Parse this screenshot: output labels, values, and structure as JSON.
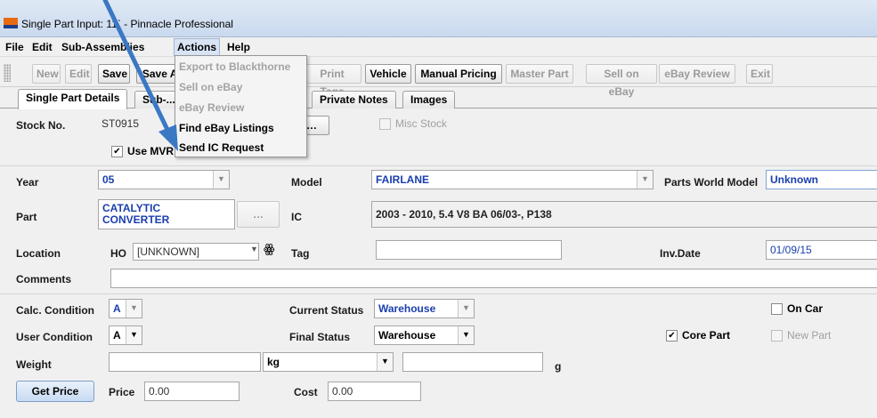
{
  "window": {
    "title": "Single Part Input: 11` - Pinnacle Professional"
  },
  "menu": {
    "file": "File",
    "edit": "Edit",
    "sub_assemblies": "Sub-Assemblies",
    "actions": "Actions",
    "help": "Help",
    "actions_items": [
      {
        "label": "Export to Blackthorne",
        "enabled": false
      },
      {
        "label": "Sell on eBay",
        "enabled": false
      },
      {
        "label": "eBay Review",
        "enabled": false
      },
      {
        "label": "Find eBay Listings",
        "enabled": true
      },
      {
        "label": "Send IC Request",
        "enabled": true
      }
    ]
  },
  "toolbar": {
    "new": "New",
    "edit": "Edit",
    "save": "Save",
    "save_as": "Save As",
    "print_tags": "Print Tags",
    "vehicle": "Vehicle",
    "manual_pricing": "Manual Pricing",
    "master_part": "Master Part",
    "sell_on_ebay": "Sell on eBay",
    "ebay_review": "eBay Review",
    "exit": "Exit"
  },
  "tabs": {
    "single_part_details": "Single Part Details",
    "sub": "Sub-...",
    "private_notes": "Private Notes",
    "images": "Images"
  },
  "form": {
    "stock_no_label": "Stock No.",
    "stock_no": "ST0915",
    "use_mvr_label": "Use MVR",
    "use_mvr_checked": true,
    "misc_stock_label": "Misc Stock",
    "misc_stock_checked": false,
    "year_label": "Year",
    "year": "05",
    "model_label": "Model",
    "model": "FAIRLANE",
    "pw_model_label": "Parts World Model",
    "pw_model": "Unknown",
    "part_label": "Part",
    "part_line1": "CATALYTIC",
    "part_line2": "CONVERTER",
    "ic_label": "IC",
    "ic": "2003 - 2010, 5.4 V8 BA 06/03-, P138",
    "location_label": "Location",
    "location_prefix": "HO",
    "location": "[UNKNOWN]",
    "tag_label": "Tag",
    "tag": "",
    "inv_date_label": "Inv.Date",
    "inv_date": "01/09/15",
    "comments_label": "Comments",
    "comments": "",
    "calc_condition_label": "Calc. Condition",
    "calc_condition": "A",
    "current_status_label": "Current Status",
    "current_status": "Warehouse",
    "on_car_label": "On Car",
    "on_car_checked": false,
    "user_condition_label": "User Condition",
    "user_condition": "A",
    "final_status_label": "Final Status",
    "final_status": "Warehouse",
    "core_part_label": "Core Part",
    "core_part_checked": true,
    "new_part_label": "New Part",
    "new_part_checked": false,
    "weight_label": "Weight",
    "weight": "",
    "weight_unit": "kg",
    "grams": "",
    "grams_unit": "g",
    "get_price_button": "Get Price",
    "price_label": "Price",
    "price": "0.00",
    "cost_label": "Cost",
    "cost": "0.00"
  },
  "colors": {
    "accent": "#1a3fae",
    "arrow": "#3b78c4",
    "app_icon": "#e86a10"
  }
}
